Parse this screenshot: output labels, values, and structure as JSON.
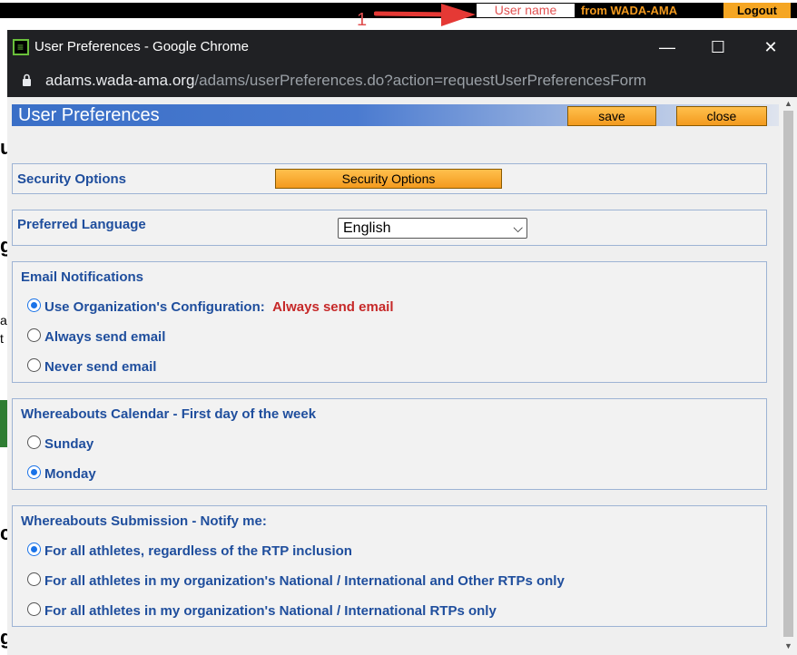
{
  "app_topbar": {
    "username": "User name",
    "from": "from WADA-AMA",
    "logout": "Logout",
    "annotation": "1"
  },
  "window": {
    "title": "User Preferences - Google Chrome",
    "url_host": "adams.wada-ama.org",
    "url_path": "/adams/userPreferences.do?action=requestUserPreferencesForm",
    "controls": {
      "minimize": "—",
      "maximize": "☐",
      "close": "✕"
    }
  },
  "header": {
    "title": "User Preferences",
    "save": "save",
    "close": "close"
  },
  "security": {
    "label": "Security Options",
    "button": "Security Options"
  },
  "language": {
    "label": "Preferred Language",
    "selected": "English"
  },
  "email": {
    "title": "Email Notifications",
    "options": [
      {
        "label": "Use Organization's Configuration:",
        "extra": "Always send email",
        "checked": true
      },
      {
        "label": "Always send email",
        "checked": false
      },
      {
        "label": "Never send email",
        "checked": false
      }
    ]
  },
  "calendar": {
    "title": "Whereabouts Calendar - First day of the week",
    "options": [
      {
        "label": "Sunday",
        "checked": false
      },
      {
        "label": "Monday",
        "checked": true
      }
    ]
  },
  "submission": {
    "title": "Whereabouts Submission - Notify me:",
    "options": [
      {
        "label": "For all athletes, regardless of the RTP inclusion",
        "checked": true
      },
      {
        "label": "For all athletes in my organization's National / International and Other RTPs only",
        "checked": false
      },
      {
        "label": "For all athletes in my organization's National / International RTPs only",
        "checked": false
      }
    ]
  },
  "colors": {
    "accent_blue": "#1f4e9d",
    "button_orange": "#f39a1e",
    "warning_red": "#c62828"
  }
}
